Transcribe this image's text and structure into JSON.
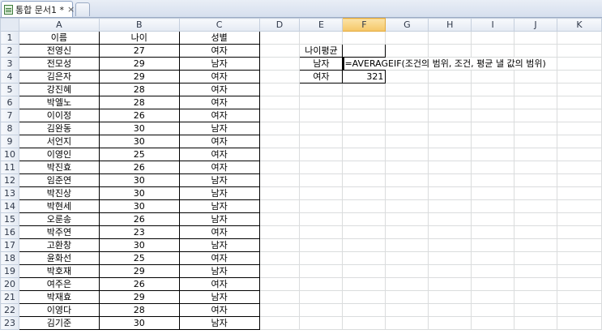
{
  "tab": {
    "title": "통합 문서1 *",
    "close": "×"
  },
  "columns": [
    "A",
    "B",
    "C",
    "D",
    "E",
    "F",
    "G",
    "H",
    "I",
    "J",
    "K"
  ],
  "rows": [
    [
      "이름",
      "나이",
      "성별"
    ],
    [
      "전영신",
      "27",
      "여자"
    ],
    [
      "전모성",
      "29",
      "남자"
    ],
    [
      "김은자",
      "29",
      "여자"
    ],
    [
      "강진혜",
      "28",
      "여자"
    ],
    [
      "박엘노",
      "28",
      "여자"
    ],
    [
      "이이정",
      "26",
      "여자"
    ],
    [
      "김완동",
      "30",
      "남자"
    ],
    [
      "서언지",
      "30",
      "여자"
    ],
    [
      "이영인",
      "25",
      "여자"
    ],
    [
      "박진효",
      "26",
      "여자"
    ],
    [
      "임준연",
      "30",
      "남자"
    ],
    [
      "박진상",
      "30",
      "남자"
    ],
    [
      "박현세",
      "30",
      "남자"
    ],
    [
      "오룬송",
      "26",
      "남자"
    ],
    [
      "박주연",
      "23",
      "여자"
    ],
    [
      "고환창",
      "30",
      "남자"
    ],
    [
      "윤화선",
      "25",
      "여자"
    ],
    [
      "박호재",
      "29",
      "남자"
    ],
    [
      "여주은",
      "26",
      "여자"
    ],
    [
      "박재효",
      "29",
      "남자"
    ],
    [
      "이영다",
      "28",
      "여자"
    ],
    [
      "김기준",
      "30",
      "남자"
    ]
  ],
  "summary": {
    "header": "나이평균",
    "male_label": "남자",
    "male_formula": "=AVERAGEIF(조건의 범위, 조건, 평균 낼 값의 범위)",
    "female_label": "여자",
    "female_value": "321"
  }
}
